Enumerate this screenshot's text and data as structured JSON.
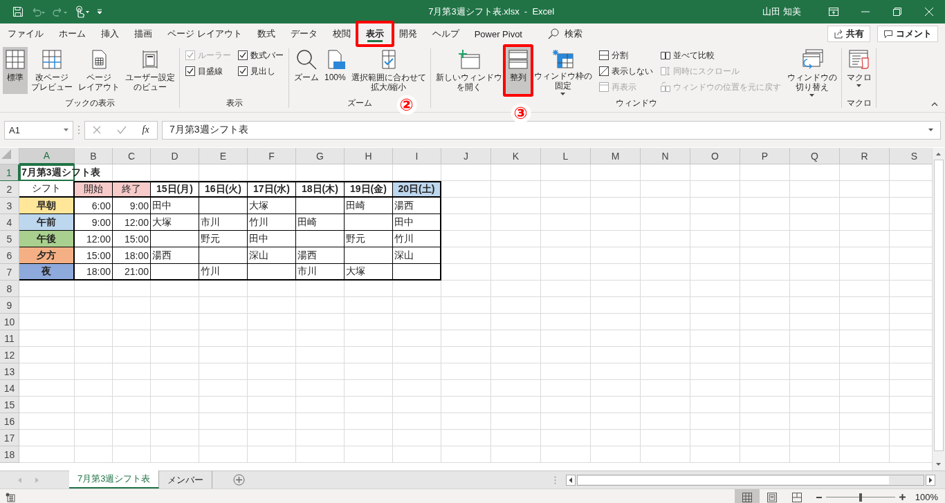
{
  "title_bar": {
    "title": "7月第3週シフト表.xlsx  -  Excel",
    "user": "山田 知美"
  },
  "menu_tabs": [
    {
      "label": "ファイル",
      "selected": false
    },
    {
      "label": "ホーム",
      "selected": false
    },
    {
      "label": "挿入",
      "selected": false
    },
    {
      "label": "描画",
      "selected": false
    },
    {
      "label": "ページ レイアウト",
      "selected": false
    },
    {
      "label": "数式",
      "selected": false
    },
    {
      "label": "データ",
      "selected": false
    },
    {
      "label": "校閲",
      "selected": false
    },
    {
      "label": "表示",
      "selected": true,
      "callout": "②"
    },
    {
      "label": "開発",
      "selected": false
    },
    {
      "label": "ヘルプ",
      "selected": false
    },
    {
      "label": "Power Pivot",
      "selected": false
    }
  ],
  "search": {
    "label": "検索"
  },
  "share_button": "共有",
  "comment_button": "コメント",
  "ribbon": {
    "groups": [
      {
        "label": "ブックの表示",
        "items": [
          {
            "kind": "large",
            "label": "標準",
            "selected": true
          },
          {
            "kind": "large",
            "lines": [
              "改ページ",
              "プレビュー"
            ],
            "selected": false
          },
          {
            "kind": "large",
            "lines": [
              "ページ",
              "レイアウト"
            ],
            "selected": false
          },
          {
            "kind": "large",
            "lines": [
              "ユーザー設定",
              "のビュー"
            ],
            "selected": false
          }
        ]
      },
      {
        "label": "表示",
        "items": [
          {
            "kind": "stack",
            "items": [
              {
                "kind": "checkbox",
                "label": "ルーラー",
                "checked": true,
                "disabled": true
              },
              {
                "kind": "checkbox",
                "label": "目盛線",
                "checked": true,
                "disabled": false
              }
            ]
          },
          {
            "kind": "stack",
            "items": [
              {
                "kind": "checkbox",
                "label": "数式バー",
                "checked": true,
                "disabled": false
              },
              {
                "kind": "checkbox",
                "label": "見出し",
                "checked": true,
                "disabled": false
              }
            ]
          }
        ]
      },
      {
        "label": "ズーム",
        "items": [
          {
            "kind": "large",
            "label": "ズーム",
            "selected": false
          },
          {
            "kind": "large",
            "label": "100%",
            "selected": false
          },
          {
            "kind": "large",
            "lines": [
              "選択範囲に合わせて",
              "拡大/縮小"
            ],
            "selected": false
          }
        ]
      },
      {
        "label": "ウィンドウ",
        "items": [
          {
            "kind": "large",
            "lines": [
              "新しいウィンドウ",
              "を開く"
            ],
            "selected": false
          },
          {
            "kind": "large",
            "label": "整列",
            "selected": true,
            "callout": "③"
          },
          {
            "kind": "large",
            "lines": [
              "ウィンドウ枠の",
              "固定"
            ],
            "selected": false,
            "dropdown": true
          },
          {
            "kind": "stack",
            "items": [
              {
                "kind": "small",
                "label": "分割",
                "disabled": false
              },
              {
                "kind": "small",
                "label": "表示しない",
                "disabled": false
              },
              {
                "kind": "small",
                "label": "再表示",
                "disabled": true
              }
            ]
          },
          {
            "kind": "stack",
            "items": [
              {
                "kind": "small",
                "label": "並べて比較",
                "disabled": false
              },
              {
                "kind": "small",
                "label": "同時にスクロール",
                "disabled": true
              },
              {
                "kind": "small",
                "label": "ウィンドウの位置を元に戻す",
                "disabled": true
              }
            ]
          },
          {
            "kind": "large",
            "lines": [
              "ウィンドウの",
              "切り替え"
            ],
            "selected": false,
            "dropdown": true
          }
        ]
      },
      {
        "label": "マクロ",
        "items": [
          {
            "kind": "large",
            "label": "マクロ",
            "selected": false,
            "dropdown": true
          }
        ]
      }
    ]
  },
  "formula_bar": {
    "name_box": "A1",
    "function_button": "fx",
    "formula": "7月第3週シフト表"
  },
  "columns": [
    {
      "label": "A",
      "selected": true
    },
    {
      "label": "B",
      "selected": false
    },
    {
      "label": "C",
      "selected": false
    },
    {
      "label": "D",
      "selected": false
    },
    {
      "label": "E",
      "selected": false
    },
    {
      "label": "F",
      "selected": false
    },
    {
      "label": "G",
      "selected": false
    },
    {
      "label": "H",
      "selected": false
    },
    {
      "label": "I",
      "selected": false
    },
    {
      "label": "J",
      "selected": false
    },
    {
      "label": "K",
      "selected": false
    },
    {
      "label": "L",
      "selected": false
    },
    {
      "label": "M",
      "selected": false
    },
    {
      "label": "N",
      "selected": false
    },
    {
      "label": "O",
      "selected": false
    },
    {
      "label": "P",
      "selected": false
    },
    {
      "label": "Q",
      "selected": false
    },
    {
      "label": "R",
      "selected": false
    },
    {
      "label": "S",
      "selected": false
    }
  ],
  "rows": [
    {
      "number": "1",
      "selected": true,
      "cells": [
        {
          "kind": "title",
          "text": "7月第3週シフト表",
          "selected": true
        }
      ]
    },
    {
      "number": "2",
      "selected": false,
      "cells": [
        {
          "kind": "heading",
          "text": "シフト"
        },
        {
          "kind": "heading",
          "text": "開始",
          "color": "#f8cbcb"
        },
        {
          "kind": "heading",
          "text": "終了",
          "color": "#f8cbcb"
        },
        {
          "kind": "date",
          "text": "15日(月)"
        },
        {
          "kind": "date",
          "text": "16日(火)"
        },
        {
          "kind": "date",
          "text": "17日(水)"
        },
        {
          "kind": "date",
          "text": "18日(木)"
        },
        {
          "kind": "date",
          "text": "19日(金)"
        },
        {
          "kind": "date",
          "text": "20日(土)",
          "color": "#bdd7ee"
        }
      ]
    },
    {
      "number": "3",
      "selected": false,
      "cells": [
        {
          "kind": "shift",
          "text": "早朝",
          "color": "#ffe699"
        },
        {
          "kind": "time",
          "text": "6:00"
        },
        {
          "kind": "time",
          "text": "9:00"
        },
        {
          "kind": "name",
          "text": "田中"
        },
        {
          "kind": "name"
        },
        {
          "kind": "name",
          "text": "大塚"
        },
        {
          "kind": "name"
        },
        {
          "kind": "name",
          "text": "田崎"
        },
        {
          "kind": "name",
          "text": "湯西"
        }
      ]
    },
    {
      "number": "4",
      "selected": false,
      "cells": [
        {
          "kind": "shift",
          "text": "午前",
          "color": "#bdd7ee"
        },
        {
          "kind": "time",
          "text": "9:00"
        },
        {
          "kind": "time",
          "text": "12:00"
        },
        {
          "kind": "name",
          "text": "大塚"
        },
        {
          "kind": "name",
          "text": "市川"
        },
        {
          "kind": "name",
          "text": "竹川"
        },
        {
          "kind": "name",
          "text": "田崎"
        },
        {
          "kind": "name"
        },
        {
          "kind": "name",
          "text": "田中"
        }
      ]
    },
    {
      "number": "5",
      "selected": false,
      "cells": [
        {
          "kind": "shift",
          "text": "午後",
          "color": "#a9d08e"
        },
        {
          "kind": "time",
          "text": "12:00"
        },
        {
          "kind": "time",
          "text": "15:00"
        },
        {
          "kind": "name"
        },
        {
          "kind": "name",
          "text": "野元"
        },
        {
          "kind": "name",
          "text": "田中"
        },
        {
          "kind": "name"
        },
        {
          "kind": "name",
          "text": "野元"
        },
        {
          "kind": "name",
          "text": "竹川"
        }
      ]
    },
    {
      "number": "6",
      "selected": false,
      "cells": [
        {
          "kind": "shift",
          "text": "夕方",
          "color": "#f4b084"
        },
        {
          "kind": "time",
          "text": "15:00"
        },
        {
          "kind": "time",
          "text": "18:00"
        },
        {
          "kind": "name",
          "text": "湯西"
        },
        {
          "kind": "name"
        },
        {
          "kind": "name",
          "text": "深山"
        },
        {
          "kind": "name",
          "text": "湯西"
        },
        {
          "kind": "name"
        },
        {
          "kind": "name",
          "text": "深山"
        }
      ]
    },
    {
      "number": "7",
      "selected": false,
      "cells": [
        {
          "kind": "shift",
          "text": "夜",
          "color": "#8ea9db"
        },
        {
          "kind": "time",
          "text": "18:00"
        },
        {
          "kind": "time",
          "text": "21:00"
        },
        {
          "kind": "name"
        },
        {
          "kind": "name",
          "text": "竹川"
        },
        {
          "kind": "name"
        },
        {
          "kind": "name",
          "text": "市川"
        },
        {
          "kind": "name",
          "text": "大塚"
        },
        {
          "kind": "name"
        }
      ]
    },
    {
      "number": "8",
      "selected": false
    },
    {
      "number": "9",
      "selected": false
    },
    {
      "number": "10",
      "selected": false
    },
    {
      "number": "11",
      "selected": false
    },
    {
      "number": "12",
      "selected": false
    },
    {
      "number": "13",
      "selected": false
    },
    {
      "number": "14",
      "selected": false
    },
    {
      "number": "15",
      "selected": false
    },
    {
      "number": "16",
      "selected": false
    },
    {
      "number": "17",
      "selected": false
    },
    {
      "number": "18",
      "selected": false
    }
  ],
  "sheet_tabs": [
    {
      "label": "7月第3週シフト表",
      "selected": true
    },
    {
      "label": "メンバー",
      "selected": false
    }
  ],
  "status_bar": {
    "views": [
      {
        "kind": "normal",
        "selected": true
      },
      {
        "kind": "page_layout",
        "selected": false
      },
      {
        "kind": "page_break",
        "selected": false
      }
    ],
    "zoom": {
      "level": 0.5,
      "reading": "100%"
    }
  }
}
